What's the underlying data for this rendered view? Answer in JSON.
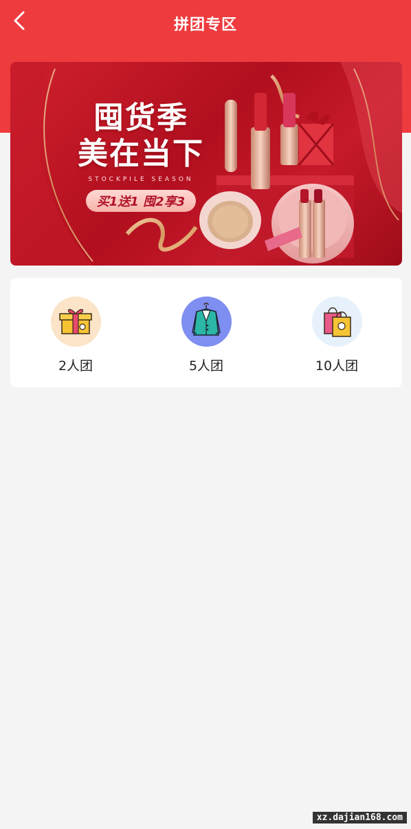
{
  "header": {
    "title": "拼团专区",
    "back_icon": "chevron-left-icon",
    "background_color": "#ee3b3e"
  },
  "banner": {
    "line1": "囤货季",
    "line2": "美在当下",
    "subtitle": "STOCKPILE SEASON",
    "promo": "买1送1 囤2享3"
  },
  "groups": [
    {
      "label": "2人团",
      "icon": "gift-box-icon",
      "icon_bg": "#fbe4c7"
    },
    {
      "label": "5人团",
      "icon": "suit-jacket-icon",
      "icon_bg": "#7f8ef1"
    },
    {
      "label": "10人团",
      "icon": "shopping-bags-icon",
      "icon_bg": "#e6f1fb"
    }
  ],
  "watermark": "xz.dajian168.com"
}
